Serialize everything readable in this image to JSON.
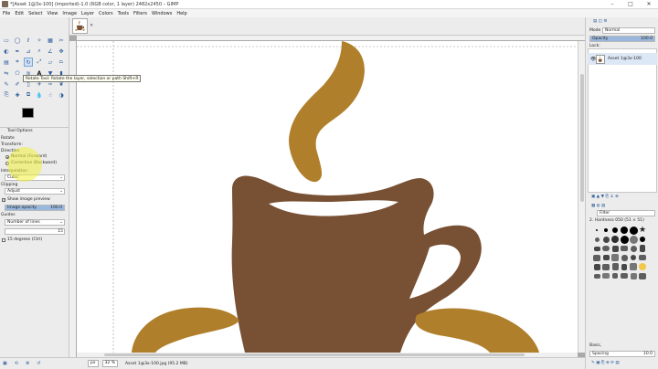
{
  "window": {
    "title": "*[Asset 1@3x-100] (imported)-1.0 (RGB color, 1 layer) 2482x2450 – GIMP",
    "minimize": "–",
    "maximize": "□",
    "close": "✕"
  },
  "menu": [
    "File",
    "Edit",
    "Select",
    "View",
    "Image",
    "Layer",
    "Colors",
    "Tools",
    "Filters",
    "Windows",
    "Help"
  ],
  "toolbox": {
    "tooltip": "Rotate Tool: Rotate the layer, selection or path  Shift+R",
    "tool_options_tab": "Tool Options",
    "tool_name": "Rotate",
    "transform_label": "Transform:",
    "direction_label": "Direction",
    "direction_normal": "Normal (Forward)",
    "direction_corrective": "Corrective (Backward)",
    "interpolation_label": "Interpolation",
    "interpolation_value": "Cubic",
    "clipping_label": "Clipping",
    "clipping_value": "Adjust",
    "show_preview_label": "Show image preview",
    "image_opacity_label": "Image opacity",
    "image_opacity_value": "100.0",
    "image_opacity_fraction": 1.0,
    "guides_label": "Guides",
    "guides_value": "Number of lines",
    "lines_value": "15",
    "degrees_label": "15 degrees (Ctrl)"
  },
  "status": {
    "unit": "px",
    "zoom": "32 %",
    "info": "Asset 1@3x-100.jpg (95.2 MB)"
  },
  "dock": {
    "mode_label": "Mode",
    "mode_value": "Normal",
    "opacity_label": "Opacity",
    "opacity_value": "100.0",
    "lock_label": "Lock:",
    "layer_name": "Asset 1@3x-100",
    "brush_filter": "Filter",
    "brush_name": "2. Hardness 050 (51 × 51)",
    "basic_label": "Basic,",
    "spacing_label": "Spacing",
    "spacing_value": "10.0"
  },
  "colors": {
    "cup": "#785033",
    "steam": "#b07f2c",
    "saucer": "#b07f2c",
    "canvas": "#ffffff",
    "highlight": "#f0f03c"
  }
}
